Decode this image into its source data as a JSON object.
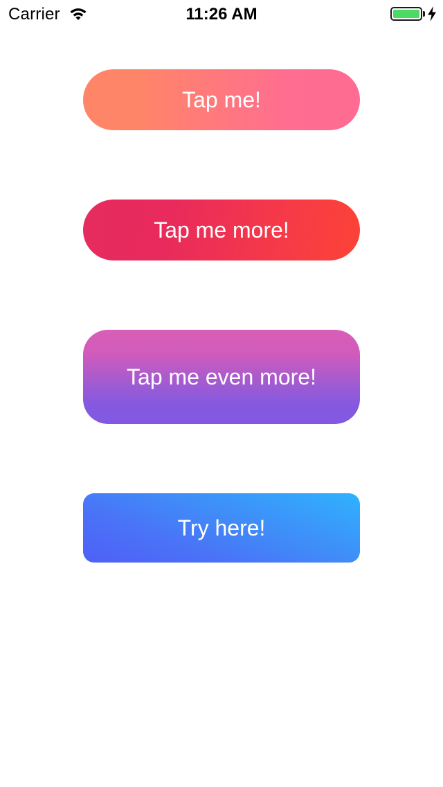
{
  "status_bar": {
    "carrier": "Carrier",
    "time": "11:26 AM",
    "battery_color": "#4cd964"
  },
  "buttons": [
    {
      "label": "Tap me!",
      "colors": [
        "#ff8569",
        "#ff6b92"
      ]
    },
    {
      "label": "Tap me more!",
      "colors": [
        "#e62b5e",
        "#fc4336"
      ]
    },
    {
      "label": "Tap me even more!",
      "colors": [
        "#d85fb7",
        "#8159e0"
      ]
    },
    {
      "label": "Try here!",
      "colors": [
        "#4f60f7",
        "#2fb2fe"
      ]
    }
  ]
}
